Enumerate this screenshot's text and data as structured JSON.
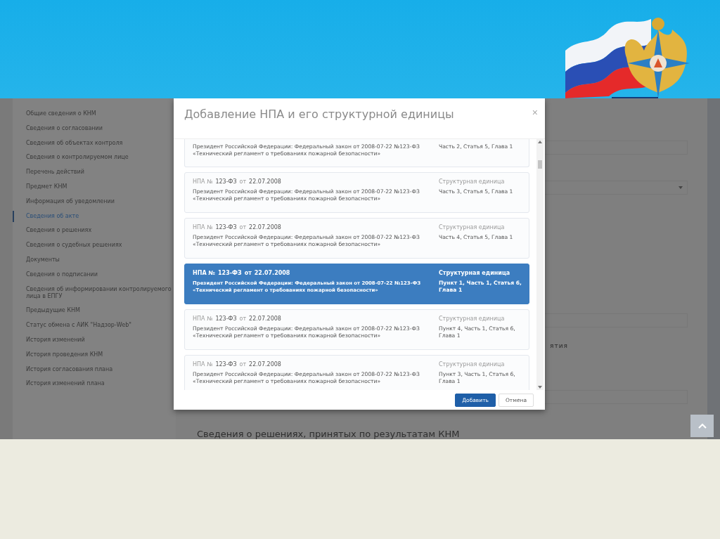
{
  "sidebar": {
    "items": [
      {
        "label": "Общие сведения о КНМ",
        "selected": false
      },
      {
        "label": "Сведения о согласовании",
        "selected": false
      },
      {
        "label": "Сведения об объектах контроля",
        "selected": false
      },
      {
        "label": "Сведения о контролируемом лице",
        "selected": false
      },
      {
        "label": "Перечень действий",
        "selected": false
      },
      {
        "label": "Предмет КНМ",
        "selected": false
      },
      {
        "label": "Информация об уведомлении",
        "selected": false
      },
      {
        "label": "Сведения об акте",
        "selected": true
      },
      {
        "label": "Сведения о решениях",
        "selected": false
      },
      {
        "label": "Сведения о судебных решениях",
        "selected": false
      },
      {
        "label": "Документы",
        "selected": false
      },
      {
        "label": "Сведения о подписании",
        "selected": false
      },
      {
        "label": "Сведения об информировании контролируемого лица в ЕПГУ",
        "selected": false
      },
      {
        "label": "Предыдущие КНМ",
        "selected": false
      },
      {
        "label": "Статус обмена с АИК \"Надзор-Web\"",
        "selected": false
      },
      {
        "label": "История изменений",
        "selected": false
      },
      {
        "label": "История проведения КНМ",
        "selected": false
      },
      {
        "label": "История согласования плана",
        "selected": false
      },
      {
        "label": "История изменений плана",
        "selected": false
      }
    ]
  },
  "main": {
    "field_label_fragment": "ятия",
    "section_heading": "Сведения о решениях, принятых по результатам КНМ"
  },
  "modal": {
    "title": "Добавление НПА и его структурной единицы",
    "close": "×",
    "cards": [
      {
        "selected": false,
        "body": "Президент Российской Федерации: Федеральный закон от 2008-07-22 №123-ФЗ\n«Технический регламент о требованиях пожарной безопасности»",
        "unit": "Часть 2, Статья 5, Глава 1"
      },
      {
        "selected": false,
        "npa_label": "НПА №",
        "number": "123-ФЗ",
        "date_label": "от",
        "date": "22.07.2008",
        "body": "Президент Российской Федерации: Федеральный закон от 2008-07-22 №123-ФЗ\n«Технический регламент о требованиях пожарной безопасности»",
        "unit_label": "Структурная единица",
        "unit": "Часть 3, Статья 5, Глава 1"
      },
      {
        "selected": false,
        "npa_label": "НПА №",
        "number": "123-ФЗ",
        "date_label": "от",
        "date": "22.07.2008",
        "body": "Президент Российской Федерации: Федеральный закон от 2008-07-22 №123-ФЗ\n«Технический регламент о требованиях пожарной безопасности»",
        "unit_label": "Структурная единица",
        "unit": "Часть 4, Статья 5, Глава 1"
      },
      {
        "selected": true,
        "npa_label": "НПА №",
        "number": "123-ФЗ",
        "date_label": "от",
        "date": "22.07.2008",
        "body": "Президент Российской Федерации: Федеральный закон от 2008-07-22 №123-ФЗ\n«Технический регламент о требованиях пожарной безопасности»",
        "unit_label": "Структурная единица",
        "unit": "Пункт 1, Часть 1, Статья 6, Глава 1"
      },
      {
        "selected": false,
        "npa_label": "НПА №",
        "number": "123-ФЗ",
        "date_label": "от",
        "date": "22.07.2008",
        "body": "Президент Российской Федерации: Федеральный закон от 2008-07-22 №123-ФЗ\n«Технический регламент о требованиях пожарной безопасности»",
        "unit_label": "Структурная единица",
        "unit": "Пункт 4, Часть 1, Статья 6, Глава 1"
      },
      {
        "selected": false,
        "npa_label": "НПА №",
        "number": "123-ФЗ",
        "date_label": "от",
        "date": "22.07.2008",
        "body": "Президент Российской Федерации: Федеральный закон от 2008-07-22 №123-ФЗ\n«Технический регламент о требованиях пожарной безопасности»",
        "unit_label": "Структурная единица",
        "unit": "Пункт 3, Часть 1, Статья 6, Глава 1"
      }
    ],
    "buttons": [
      {
        "label": "Добавить",
        "kind": "primary"
      },
      {
        "label": "Отмена",
        "kind": "secondary"
      }
    ]
  }
}
